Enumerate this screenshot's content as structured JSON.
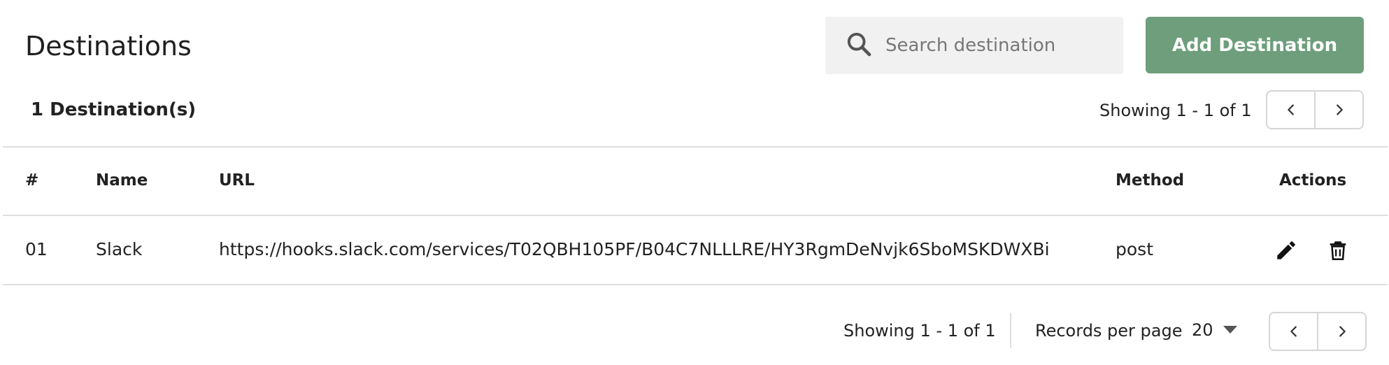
{
  "header": {
    "title": "Destinations",
    "search_placeholder": "Search destination",
    "search_value": "",
    "add_button_label": "Add Destination"
  },
  "summary": {
    "count_label": "1 Destination(s)",
    "showing_top": "Showing 1 - 1 of 1"
  },
  "table": {
    "columns": {
      "index": "#",
      "name": "Name",
      "url": "URL",
      "method": "Method",
      "actions": "Actions"
    },
    "rows": [
      {
        "index": "01",
        "name": "Slack",
        "url": "https://hooks.slack.com/services/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",
        "method": "post"
      }
    ]
  },
  "footer": {
    "showing_bottom": "Showing 1 - 1 of 1",
    "records_per_page_label": "Records per page",
    "records_per_page_value": "20"
  },
  "icons": {
    "search": "search-icon",
    "prev": "chevron-left-icon",
    "next": "chevron-right-icon",
    "edit": "pencil-icon",
    "delete": "trash-icon",
    "dropdown": "caret-down-icon"
  },
  "colors": {
    "primary_button": "#6e9e7c",
    "search_bg": "#f1f1f1",
    "divider": "#dedede"
  }
}
